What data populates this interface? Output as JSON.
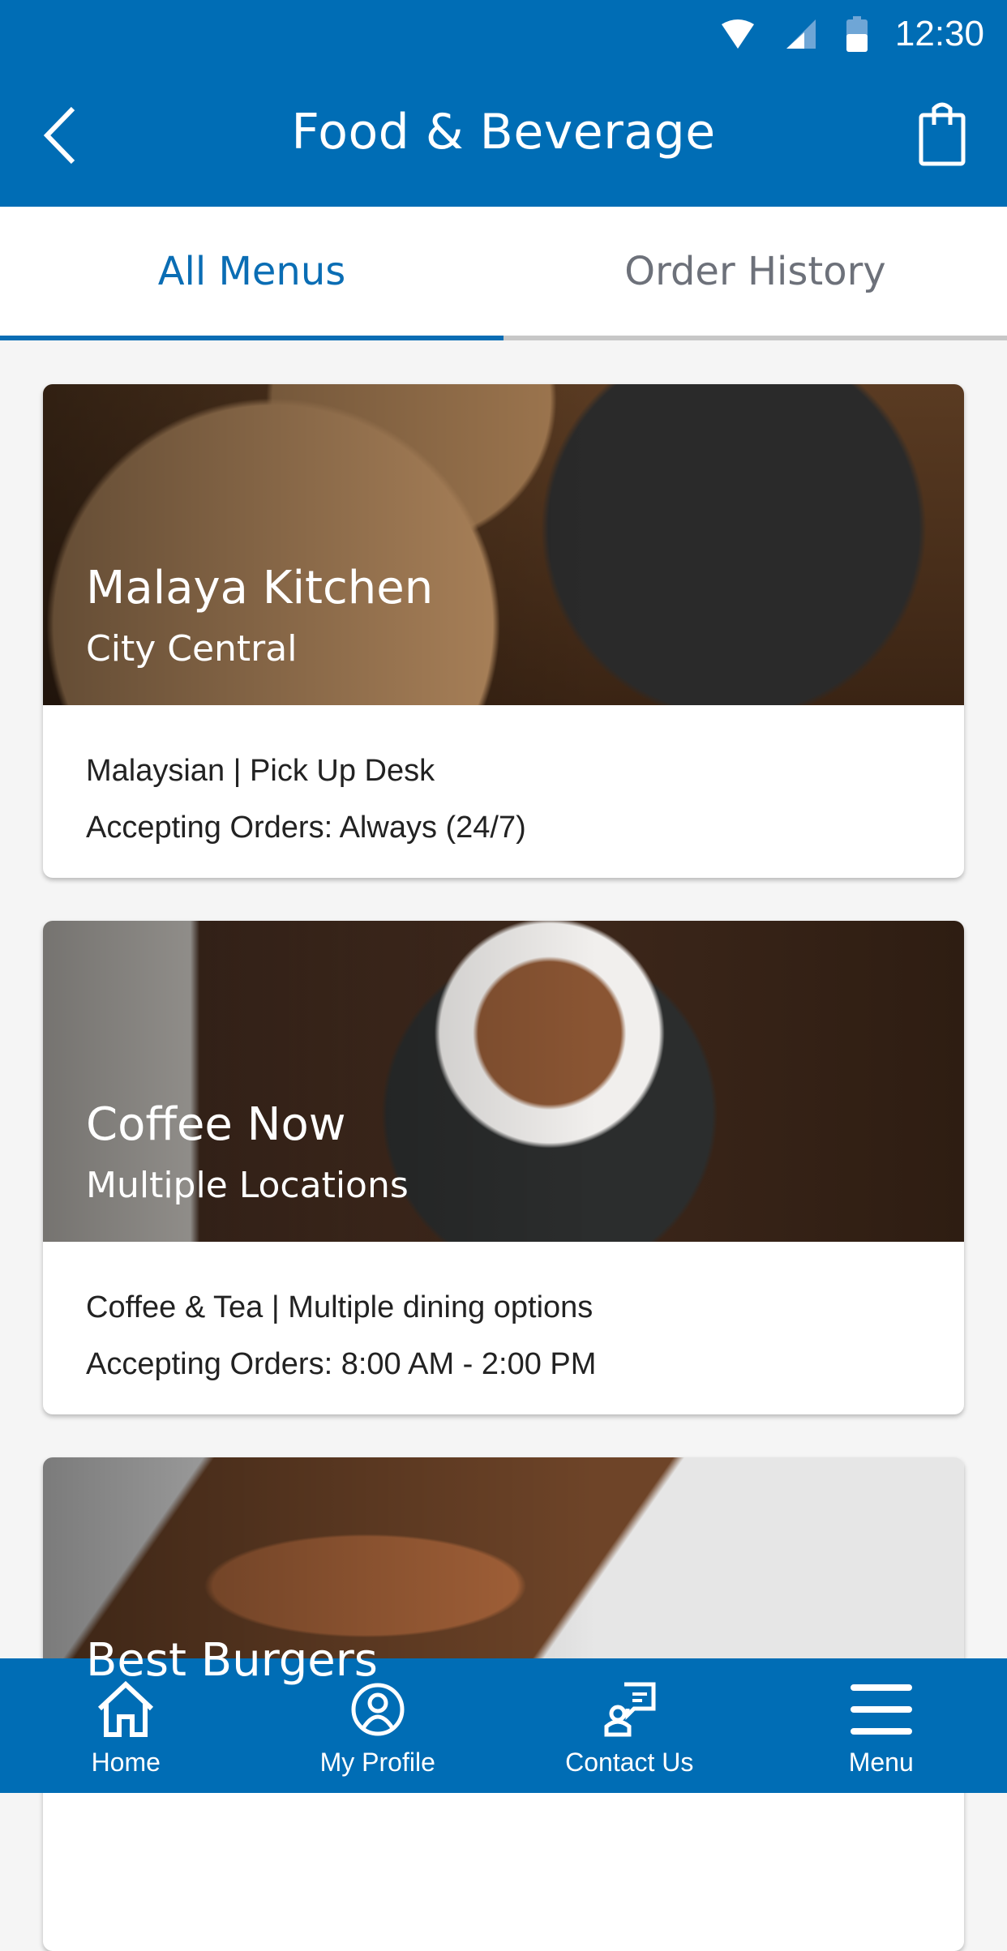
{
  "status_bar": {
    "time": "12:30",
    "icons": [
      "wifi-icon",
      "signal-icon",
      "battery-icon"
    ]
  },
  "app_bar": {
    "title": "Food & Beverage",
    "back_icon": "chevron-left-icon",
    "cart_icon": "shopping-bag-icon"
  },
  "tabs": [
    {
      "label": "All Menus",
      "active": true
    },
    {
      "label": "Order History",
      "active": false
    }
  ],
  "restaurants": [
    {
      "name": "Malaya Kitchen",
      "location": "City Central",
      "details": "Malaysian  |  Pick Up Desk",
      "hours": "Accepting Orders: Always (24/7)"
    },
    {
      "name": "Coffee Now",
      "location": "Multiple Locations",
      "details": "Coffee & Tea  |  Multiple dining options",
      "hours": "Accepting Orders: 8:00 AM - 2:00 PM"
    },
    {
      "name": "Best Burgers"
    }
  ],
  "bottom_nav": [
    {
      "label": "Home",
      "icon": "home-icon"
    },
    {
      "label": "My Profile",
      "icon": "profile-icon"
    },
    {
      "label": "Contact Us",
      "icon": "contact-icon"
    },
    {
      "label": "Menu",
      "icon": "hamburger-menu-icon"
    }
  ],
  "colors": {
    "primary": "#006db5",
    "tab_inactive": "#6d717a",
    "background": "#f5f5f5"
  }
}
